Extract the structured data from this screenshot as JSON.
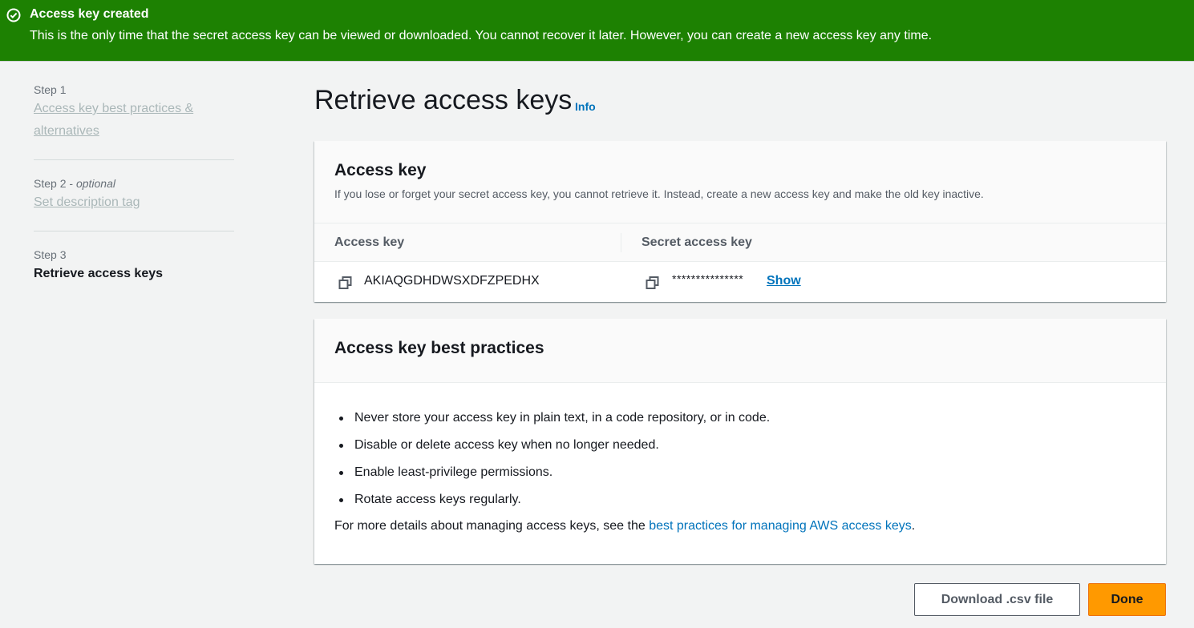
{
  "flash": {
    "icon": "check-circle-icon",
    "title": "Access key created",
    "message": "This is the only time that the secret access key can be viewed or downloaded. You cannot recover it later. However, you can create a new access key any time.",
    "color": "#1d8102"
  },
  "steps": [
    {
      "label": "Step 1",
      "title": "Access key best practices & alternatives"
    },
    {
      "label": "Step 2",
      "optional": "optional",
      "title": "Set description tag"
    },
    {
      "label": "Step 3",
      "title": "Retrieve access keys"
    }
  ],
  "page": {
    "title": "Retrieve access keys",
    "info": "Info"
  },
  "access_key_panel": {
    "title": "Access key",
    "description": "If you lose or forget your secret access key, you cannot retrieve it. Instead, create a new access key and make the old key inactive.",
    "columns": [
      "Access key",
      "Secret access key"
    ],
    "access_key_id": "AKIAQGDHDWSXDFZPEDHX",
    "secret_masked": "***************",
    "show_label": "Show",
    "copy_icon": "copy-icon"
  },
  "best_practices": {
    "title": "Access key best practices",
    "items": [
      "Never store your access key in plain text, in a code repository, or in code.",
      "Disable or delete access key when no longer needed.",
      "Enable least-privilege permissions.",
      "Rotate access keys regularly."
    ],
    "footer_prefix": "For more details about managing access keys, see the ",
    "footer_link": "best practices for managing AWS access keys",
    "footer_suffix": "."
  },
  "actions": {
    "download": "Download .csv file",
    "done": "Done"
  },
  "colors": {
    "primary": "#ff9900",
    "link": "#0073bb",
    "success": "#1d8102"
  }
}
